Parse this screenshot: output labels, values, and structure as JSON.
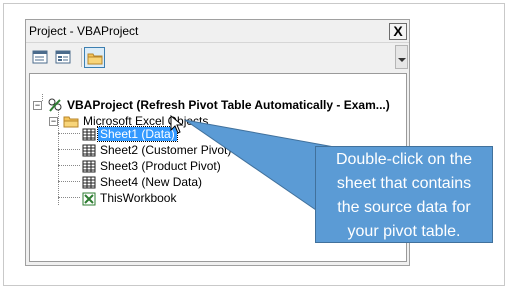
{
  "window": {
    "title": "Project - VBAProject",
    "close_glyph": "X"
  },
  "toolbar": {
    "buttons": [
      {
        "name": "view-code-icon"
      },
      {
        "name": "view-object-icon"
      },
      {
        "name": "toggle-folders-icon"
      }
    ]
  },
  "tree": {
    "project": "VBAProject (Refresh Pivot Table Automatically - Exam...)",
    "folder": "Microsoft Excel Objects",
    "items": [
      "Sheet1 (Data)",
      "Sheet2 (Customer Pivot)",
      "Sheet3 (Product Pivot)",
      "Sheet4 (New Data)",
      "ThisWorkbook"
    ],
    "selected_index": 0
  },
  "callout": {
    "lines": [
      "Double-click on the",
      "sheet that contains",
      "the source data for",
      "your pivot table."
    ],
    "color": "#5b9bd5"
  }
}
